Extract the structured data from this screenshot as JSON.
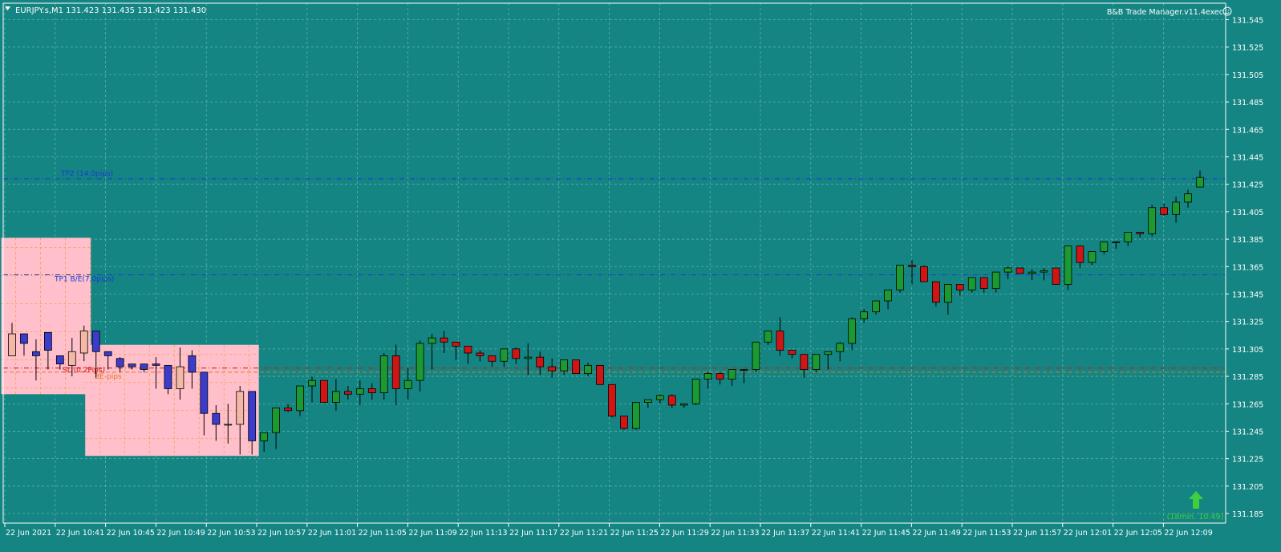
{
  "header": {
    "symbol_menu_icon": "triangle-down-icon",
    "title": "EURJPY.s,M1  131.423 131.435 131.423 131.430",
    "ea_name": "B&B Trade Manager.v11.4exec",
    "ea_icon": "smiley-icon"
  },
  "colors": {
    "background": "#148582",
    "grid": "#5fb1ab",
    "axis_text": "#ffffff",
    "bull_candle": "#1a9a30",
    "bear_candle": "#d01515",
    "zone_fill": "#ffc0cb",
    "zone_grid": "#f2a150",
    "zone_bull_candle": "#f5b8a6",
    "zone_bear_candle": "#3b3bcc",
    "tp_line": "#1a3ad6",
    "sl_line": "#d01515",
    "entry_line": "#e07a20",
    "arrow": "#3ecf3e",
    "timer_text": "#3ecf3e"
  },
  "chart_data": {
    "type": "candlestick",
    "symbol": "EURJPY.s",
    "timeframe": "M1",
    "ohlc_header": {
      "open": 131.423,
      "high": 131.435,
      "low": 131.423,
      "close": 131.43
    },
    "ylim": [
      131.178,
      131.557
    ],
    "y_ticks": [
      "131.545",
      "131.525",
      "131.505",
      "131.485",
      "131.465",
      "131.445",
      "131.425",
      "131.405",
      "131.385",
      "131.365",
      "131.345",
      "131.325",
      "131.305",
      "131.285",
      "131.265",
      "131.245",
      "131.225",
      "131.205",
      "131.185"
    ],
    "x_ticks": [
      "22 Jun 2021",
      "22 Jun 10:41",
      "22 Jun 10:45",
      "22 Jun 10:49",
      "22 Jun 10:53",
      "22 Jun 10:57",
      "22 Jun 11:01",
      "22 Jun 11:05",
      "22 Jun 11:09",
      "22 Jun 11:13",
      "22 Jun 11:17",
      "22 Jun 11:21",
      "22 Jun 11:25",
      "22 Jun 11:29",
      "22 Jun 11:33",
      "22 Jun 11:37",
      "22 Jun 11:41",
      "22 Jun 11:45",
      "22 Jun 11:49",
      "22 Jun 11:53",
      "22 Jun 11:57",
      "22 Jun 12:01",
      "22 Jun 12:05",
      "22 Jun 12:09"
    ],
    "candles": [
      [
        131.3,
        131.336,
        131.316,
        131.324
      ],
      [
        131.316,
        131.3,
        131.309,
        131.316
      ],
      [
        131.303,
        131.282,
        131.3,
        131.312
      ],
      [
        131.317,
        131.29,
        131.304,
        131.317
      ],
      [
        131.3,
        131.29,
        131.294,
        131.3
      ],
      [
        131.293,
        131.285,
        131.303,
        131.313
      ],
      [
        131.302,
        131.296,
        131.318,
        131.322
      ],
      [
        131.318,
        131.284,
        131.303,
        131.318
      ],
      [
        131.303,
        131.29,
        131.3,
        131.303
      ],
      [
        131.298,
        131.288,
        131.292,
        131.299
      ],
      [
        131.294,
        131.29,
        131.292,
        131.294
      ],
      [
        131.294,
        131.288,
        131.29,
        131.294
      ],
      [
        131.294,
        131.276,
        131.293,
        131.299
      ],
      [
        131.293,
        131.272,
        131.276,
        131.293
      ],
      [
        131.276,
        131.268,
        131.292,
        131.306
      ],
      [
        131.3,
        131.276,
        131.288,
        131.304
      ],
      [
        131.288,
        131.242,
        131.258,
        131.288
      ],
      [
        131.258,
        131.238,
        131.25,
        131.264
      ],
      [
        131.25,
        131.236,
        131.25,
        131.265
      ],
      [
        131.25,
        131.228,
        131.274,
        131.278
      ],
      [
        131.274,
        131.228,
        131.238,
        131.274
      ],
      [
        131.238,
        131.23,
        131.244,
        131.244
      ],
      [
        131.244,
        131.232,
        131.262,
        131.262
      ],
      [
        131.262,
        131.259,
        131.26,
        131.265
      ],
      [
        131.26,
        131.256,
        131.278,
        131.278
      ],
      [
        131.278,
        131.266,
        131.282,
        131.285
      ],
      [
        131.282,
        131.268,
        131.266,
        131.282
      ],
      [
        131.266,
        131.26,
        131.274,
        131.283
      ],
      [
        131.274,
        131.268,
        131.272,
        131.278
      ],
      [
        131.272,
        131.264,
        131.276,
        131.282
      ],
      [
        131.276,
        131.268,
        131.273,
        131.28
      ],
      [
        131.273,
        131.268,
        131.3,
        131.302
      ],
      [
        131.3,
        131.264,
        131.276,
        131.308
      ],
      [
        131.276,
        131.268,
        131.282,
        131.291
      ],
      [
        131.282,
        131.274,
        131.309,
        131.311
      ],
      [
        131.309,
        131.29,
        131.313,
        131.316
      ],
      [
        131.313,
        131.302,
        131.31,
        131.318
      ],
      [
        131.31,
        131.297,
        131.307,
        131.31
      ],
      [
        131.307,
        131.294,
        131.302,
        131.307
      ],
      [
        131.302,
        131.296,
        131.3,
        131.304
      ],
      [
        131.3,
        131.292,
        131.296,
        131.3
      ],
      [
        131.296,
        131.292,
        131.305,
        131.305
      ],
      [
        131.305,
        131.294,
        131.298,
        131.306
      ],
      [
        131.298,
        131.286,
        131.299,
        131.309
      ],
      [
        131.299,
        131.286,
        131.292,
        131.303
      ],
      [
        131.292,
        131.284,
        131.289,
        131.298
      ],
      [
        131.289,
        131.286,
        131.297,
        131.297
      ],
      [
        131.297,
        131.289,
        131.287,
        131.297
      ],
      [
        131.287,
        131.285,
        131.293,
        131.295
      ],
      [
        131.293,
        131.284,
        131.279,
        131.293
      ],
      [
        131.279,
        131.255,
        131.256,
        131.279
      ],
      [
        131.256,
        131.246,
        131.247,
        131.256
      ],
      [
        131.247,
        131.246,
        131.266,
        131.266
      ],
      [
        131.266,
        131.262,
        131.268,
        131.268
      ],
      [
        131.268,
        131.265,
        131.271,
        131.272
      ],
      [
        131.271,
        131.262,
        131.264,
        131.272
      ],
      [
        131.264,
        131.262,
        131.265,
        131.265
      ],
      [
        131.265,
        131.264,
        131.283,
        131.283
      ],
      [
        131.283,
        131.276,
        131.287,
        131.288
      ],
      [
        131.287,
        131.279,
        131.283,
        131.288
      ],
      [
        131.283,
        131.278,
        131.29,
        131.29
      ],
      [
        131.29,
        131.28,
        131.29,
        131.29
      ],
      [
        131.29,
        131.288,
        131.31,
        131.31
      ],
      [
        131.31,
        131.308,
        131.318,
        131.318
      ],
      [
        131.318,
        131.3,
        131.304,
        131.328
      ],
      [
        131.304,
        131.298,
        131.301,
        131.304
      ],
      [
        131.301,
        131.284,
        131.29,
        131.301
      ],
      [
        131.29,
        131.288,
        131.301,
        131.301
      ],
      [
        131.301,
        131.29,
        131.303,
        131.303
      ],
      [
        131.303,
        131.296,
        131.309,
        131.31
      ],
      [
        131.309,
        131.304,
        131.327,
        131.328
      ],
      [
        131.327,
        131.324,
        131.332,
        131.334
      ],
      [
        131.332,
        131.33,
        131.34,
        131.34
      ],
      [
        131.34,
        131.334,
        131.348,
        131.348
      ],
      [
        131.348,
        131.346,
        131.366,
        131.366
      ],
      [
        131.366,
        131.352,
        131.365,
        131.37
      ],
      [
        131.365,
        131.354,
        131.354,
        131.366
      ],
      [
        131.354,
        131.336,
        131.339,
        131.354
      ],
      [
        131.339,
        131.33,
        131.352,
        131.352
      ],
      [
        131.352,
        131.344,
        131.348,
        131.352
      ],
      [
        131.348,
        131.346,
        131.357,
        131.357
      ],
      [
        131.357,
        131.346,
        131.349,
        131.357
      ],
      [
        131.349,
        131.346,
        131.361,
        131.361
      ],
      [
        131.361,
        131.356,
        131.364,
        131.365
      ],
      [
        131.364,
        131.36,
        131.36,
        131.364
      ],
      [
        131.36,
        131.355,
        131.361,
        131.363
      ],
      [
        131.361,
        131.355,
        131.362,
        131.364
      ],
      [
        131.364,
        131.352,
        131.352,
        131.364
      ],
      [
        131.352,
        131.348,
        131.38,
        131.38
      ],
      [
        131.38,
        131.364,
        131.368,
        131.38
      ],
      [
        131.368,
        131.366,
        131.376,
        131.376
      ],
      [
        131.376,
        131.374,
        131.383,
        131.383
      ],
      [
        131.383,
        131.378,
        131.383,
        131.383
      ],
      [
        131.383,
        131.38,
        131.39,
        131.39
      ],
      [
        131.39,
        131.386,
        131.389,
        131.39
      ],
      [
        131.389,
        131.387,
        131.408,
        131.41
      ],
      [
        131.408,
        131.402,
        131.403,
        131.411
      ],
      [
        131.403,
        131.397,
        131.412,
        131.416
      ],
      [
        131.412,
        131.408,
        131.418,
        131.421
      ],
      [
        131.423,
        131.423,
        131.43,
        131.435
      ]
    ],
    "levels": [
      {
        "label": "TP2 (14.0pips)",
        "value": 131.429,
        "price_tag": "131.429",
        "style": "dashdot",
        "color": "#1a3ad6"
      },
      {
        "label": "TP1 B/E(7.0pips)",
        "value": 131.359,
        "price_tag": "131.359",
        "style": "dashdot",
        "color": "#1a3ad6"
      },
      {
        "label": "SL (0.2Pips)",
        "value": 131.291,
        "price_tag": "131.291",
        "style": "dashdot",
        "color": "#d01515"
      },
      {
        "label": "BE-pips",
        "value": 131.288,
        "price_tag": "",
        "style": "dashed",
        "color": "#e07a20"
      }
    ],
    "zones": [
      {
        "name": "zone-1",
        "price_top": 131.386,
        "price_bottom": 131.272,
        "candles_from": 0,
        "candles_to": 6
      },
      {
        "name": "zone-2",
        "price_top": 131.308,
        "price_bottom": 131.227,
        "candles_from": 7,
        "candles_to": 20
      }
    ],
    "timer_text": "(18min. 10:49)",
    "grid": true
  }
}
